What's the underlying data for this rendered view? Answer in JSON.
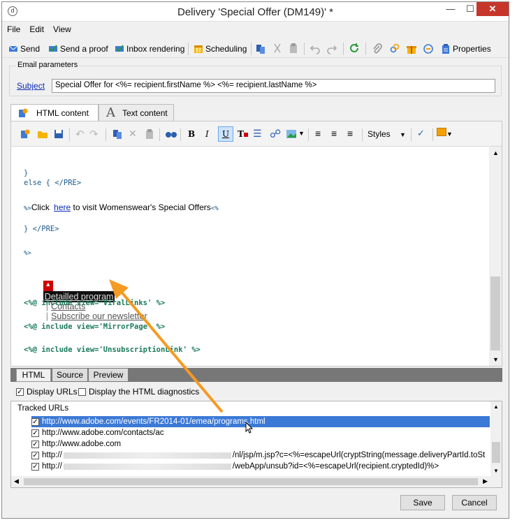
{
  "window": {
    "title": "Delivery 'Special Offer (DM149)' *",
    "app_icon": "d"
  },
  "menu": [
    "File",
    "Edit",
    "View"
  ],
  "toolbar": {
    "send": "Send",
    "send_proof": "Send a proof",
    "inbox_rendering": "Inbox rendering",
    "scheduling": "Scheduling",
    "properties": "Properties"
  },
  "email_params": {
    "legend": "Email parameters",
    "subject_label": "Subject",
    "subject_value": "Special Offer for <%= recipient.firstName %> <%= recipient.lastName %>"
  },
  "content_tabs": [
    "HTML content",
    "Text content"
  ],
  "editor_toolbar": {
    "bold": "B",
    "italic": "I",
    "underline": "U",
    "styles": "Styles"
  },
  "code": {
    "l1": "}",
    "l2": "else { </PRE>",
    "l3_prefix": "%>",
    "l3_click": "Click",
    "l3_here": "here",
    "l3_rest": " to visit Womenswear's Special Offers",
    "l3_suffix": "<%",
    "l4": "} </PRE>",
    "l5": "%>",
    "detail_program": "Detailled program",
    "sep": "|",
    "contacts": "Contacts",
    "subscribe": "Subscribe our newsletter",
    "inc1": "<%@ include view='ViralLinks' %>",
    "inc2": "<%@ include view='MirrorPage' %>",
    "inc3": "<%@ include view='UnsubscriptionLink' %>"
  },
  "view_tabs": [
    "HTML",
    "Source",
    "Preview"
  ],
  "options": {
    "display_urls": "Display URLs",
    "display_html_diag": "Display the HTML diagnostics"
  },
  "tracked": {
    "label": "Tracked URLs",
    "rows": [
      "http://www.adobe.com/events/FR2014-01/emea/programs.html",
      "http://www.adobe.com/contacts/ac",
      "http://www.adobe.com",
      "/nl/jsp/m.jsp?c=<%=escapeUrl(cryptString(message.deliveryPartId.toSt",
      "/webApp/unsub?id=<%=escapeUrl(recipient.cryptedId)%>"
    ],
    "row_prefix": "http://"
  },
  "buttons": {
    "save": "Save",
    "cancel": "Cancel"
  },
  "colors": {
    "accent": "#3b79d6",
    "link": "#0a2bb5",
    "code_green": "#1a7a5a",
    "arrow": "#f59a23"
  }
}
